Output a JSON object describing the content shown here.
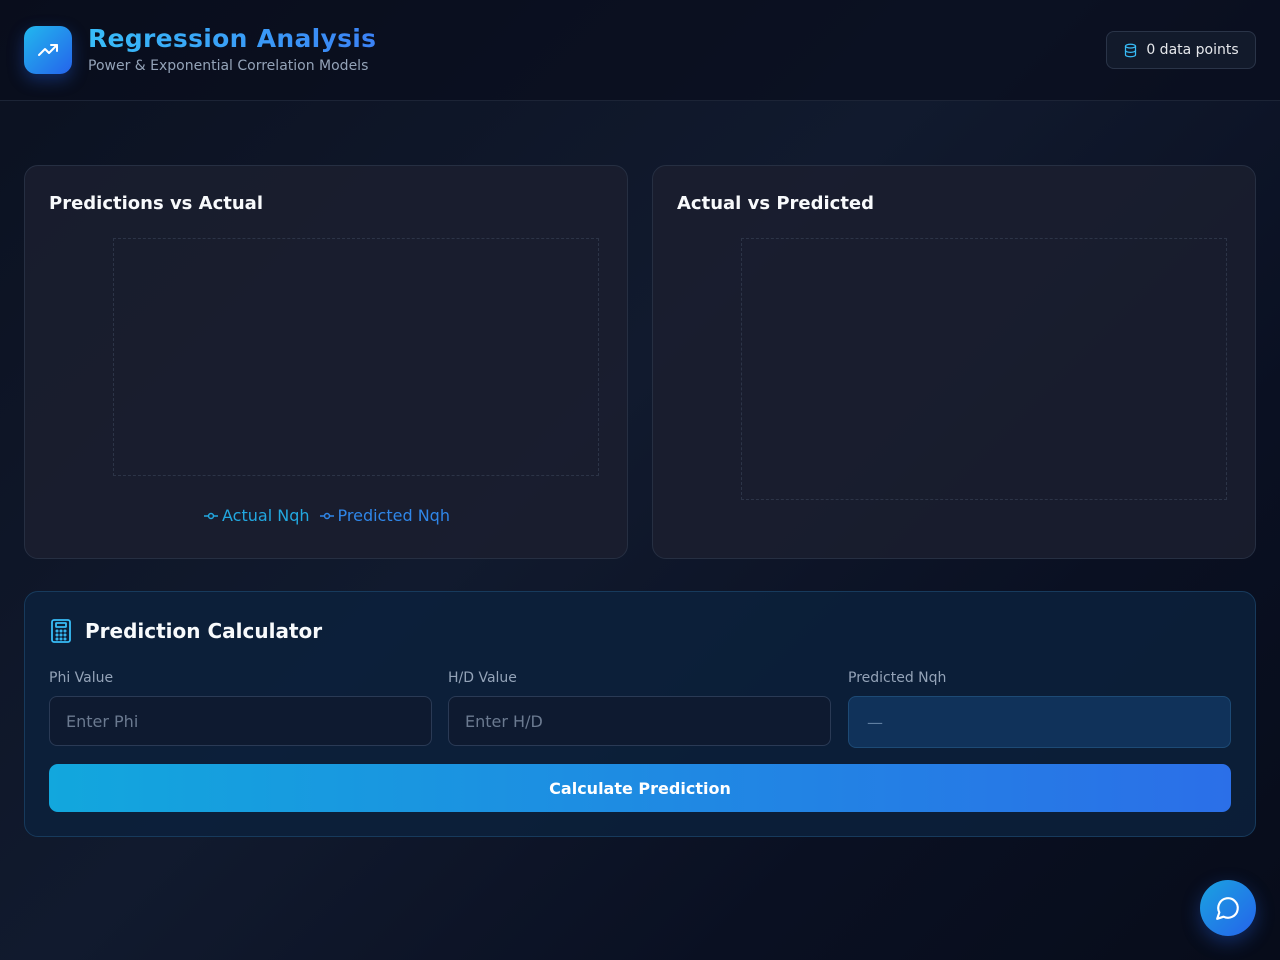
{
  "header": {
    "title": "Regression Analysis",
    "subtitle": "Power & Exponential Correlation Models",
    "logo_icon": "trending-up-icon",
    "data_points_badge": "0 data points",
    "badge_icon": "database-icon"
  },
  "charts": {
    "left": {
      "title": "Predictions vs Actual",
      "legend": [
        {
          "label": "Actual Nqh",
          "color": "#22a8e0"
        },
        {
          "label": "Predicted Nqh",
          "color": "#2f86e8"
        }
      ]
    },
    "right": {
      "title": "Actual vs Predicted"
    }
  },
  "calculator": {
    "title": "Prediction Calculator",
    "icon": "calculator-icon",
    "phi": {
      "label": "Phi Value",
      "placeholder": "Enter Phi",
      "value": ""
    },
    "hd": {
      "label": "H/D Value",
      "placeholder": "Enter H/D",
      "value": ""
    },
    "result": {
      "label": "Predicted Nqh",
      "value": "—"
    },
    "button_label": "Calculate Prediction"
  },
  "chat": {
    "icon": "chat-bubble-icon"
  },
  "colors": {
    "accent": "#38bdf8",
    "accent_blue": "#2563eb",
    "background": "#0b1120"
  },
  "chart_data": [
    {
      "type": "line",
      "title": "Predictions vs Actual",
      "series": [
        {
          "name": "Actual Nqh",
          "values": []
        },
        {
          "name": "Predicted Nqh",
          "values": []
        }
      ],
      "x": [],
      "grid": true,
      "legend": "bottom-center"
    },
    {
      "type": "scatter",
      "title": "Actual vs Predicted",
      "x": [],
      "y": [],
      "grid": true
    }
  ]
}
